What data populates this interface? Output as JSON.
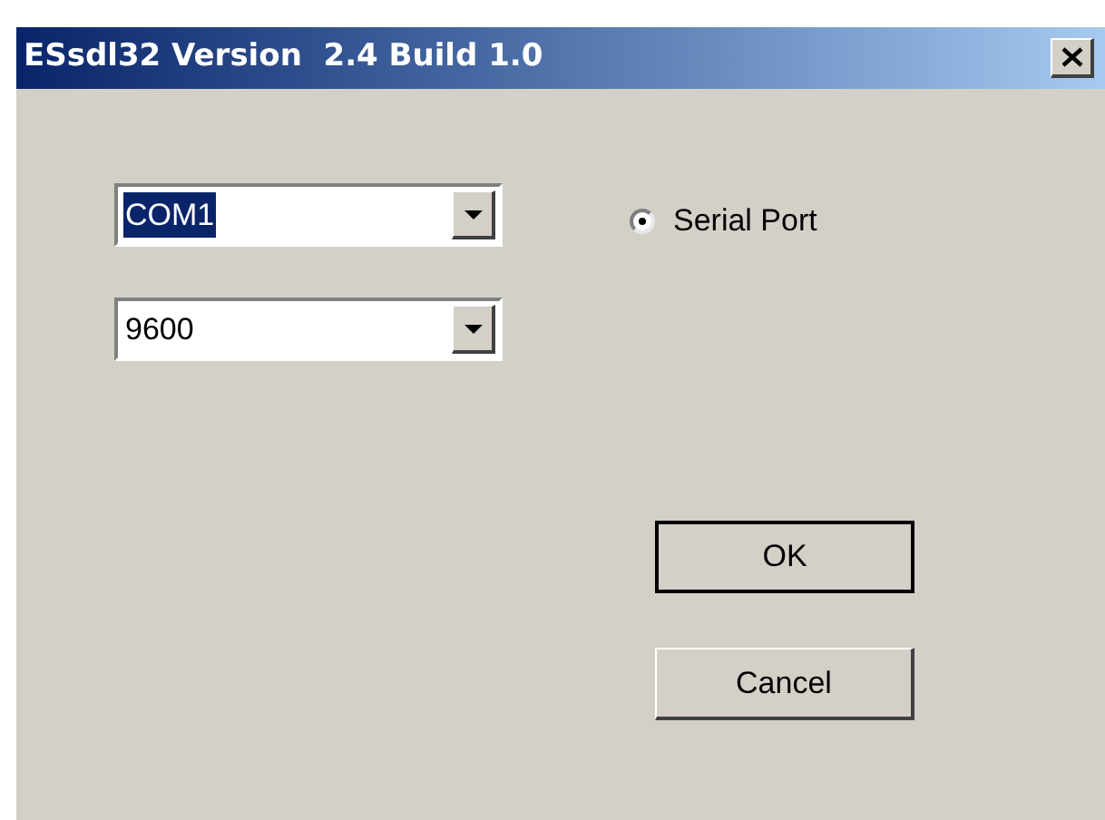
{
  "window": {
    "title": "ESsdl32 Version  2.4 Build 1.0"
  },
  "combos": [
    {
      "value": "COM1",
      "highlighted": true
    },
    {
      "value": "9600",
      "highlighted": false
    }
  ],
  "radios": [
    {
      "label": "Serial Port",
      "selected": true
    }
  ],
  "buttons": [
    {
      "label": "OK",
      "default": true
    },
    {
      "label": "Cancel",
      "default": false
    }
  ]
}
